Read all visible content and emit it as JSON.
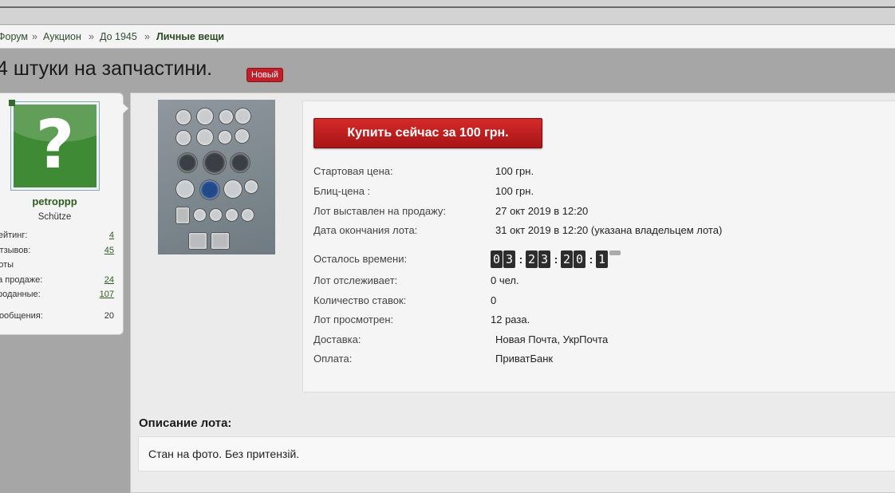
{
  "breadcrumb": {
    "items": [
      "Форум",
      "Аукцион",
      "До 1945",
      "Личные вещи"
    ],
    "separator": "»"
  },
  "thread": {
    "title": "4 штуки на запчастини.",
    "badge": "Новый"
  },
  "user": {
    "name": "petroppp",
    "title": "Schütze",
    "stats": [
      {
        "label": "Рейтинг:",
        "value": "4",
        "link": true
      },
      {
        "label": "Отзывов:",
        "value": "45",
        "link": true
      },
      {
        "label": "Лоты",
        "value": "",
        "link": false
      },
      {
        "label": "на продаже:",
        "value": "24",
        "link": true
      },
      {
        "label": "проданные:",
        "value": "107",
        "link": true
      },
      {
        "label": "Сообщения:",
        "value": "20",
        "link": false
      }
    ]
  },
  "lot": {
    "buy_button": "Купить сейчас за 100 грн.",
    "fields": [
      {
        "label": "Стартовая цена:",
        "value": "100 грн."
      },
      {
        "label": "Блиц-цена :",
        "value": "100 грн."
      },
      {
        "label": "Лот выставлен на продажу:",
        "value": "27 окт 2019 в 12:20"
      },
      {
        "label": "Дата окончания лота:",
        "value": "31 окт 2019 в 12:20 (указана владельцем лота)"
      },
      {
        "label": "Осталось времени:",
        "value": ""
      },
      {
        "label": "Лот отслеживает:",
        "value": "0 чел."
      },
      {
        "label": "Количество ставок:",
        "value": "0"
      },
      {
        "label": "Лот просмотрен:",
        "value": "12 раза."
      },
      {
        "label": "Доставка:",
        "value": "Новая Почта, УкрПочта"
      },
      {
        "label": "Оплата:",
        "value": "ПриватБанк"
      }
    ],
    "countdown": {
      "h": "03",
      "m": "23",
      "s": "20",
      "extra": "1"
    }
  },
  "description": {
    "heading": "Описание лота:",
    "text": "Стан на фото. Без притензій."
  }
}
